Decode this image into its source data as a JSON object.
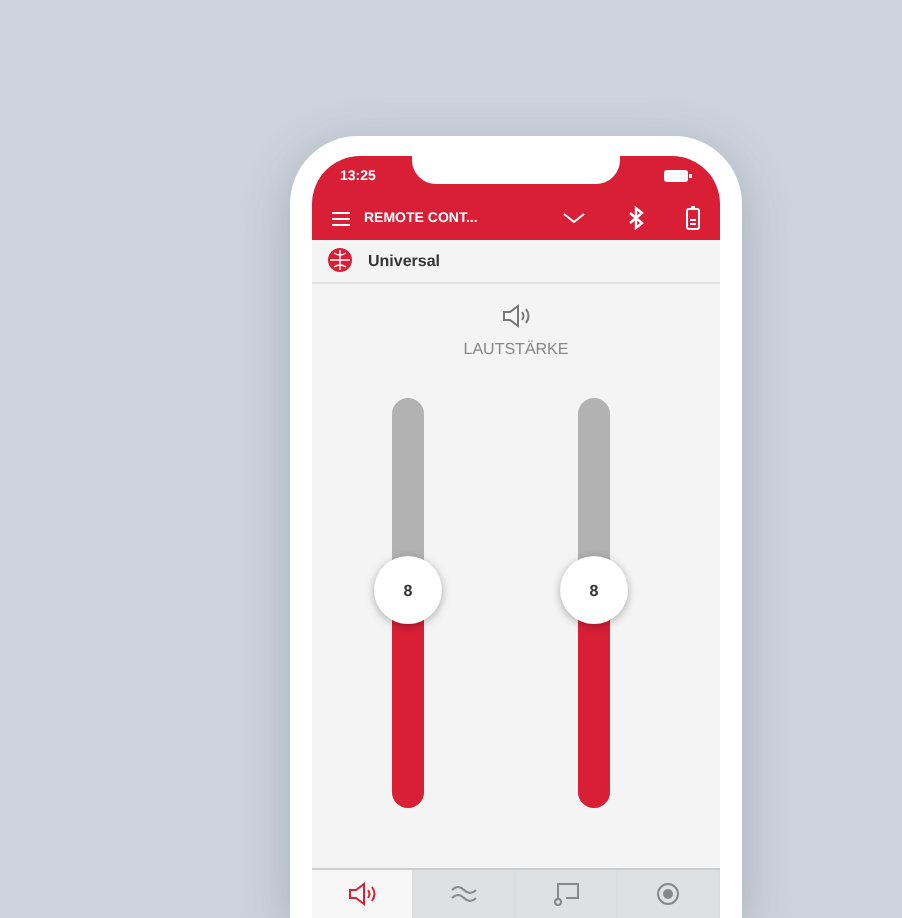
{
  "status_bar": {
    "time": "13:25"
  },
  "header": {
    "title": "REMOTE CONT..."
  },
  "program": {
    "name": "Universal"
  },
  "section": {
    "label": "LAUTSTÄRKE"
  },
  "sliders": [
    {
      "value": "8",
      "level": 0.53
    },
    {
      "value": "8",
      "level": 0.53
    }
  ],
  "tabs": [
    {
      "kind": "volume",
      "selected": true
    },
    {
      "kind": "noise",
      "selected": false
    },
    {
      "kind": "stream",
      "selected": false
    },
    {
      "kind": "target",
      "selected": false
    }
  ]
}
